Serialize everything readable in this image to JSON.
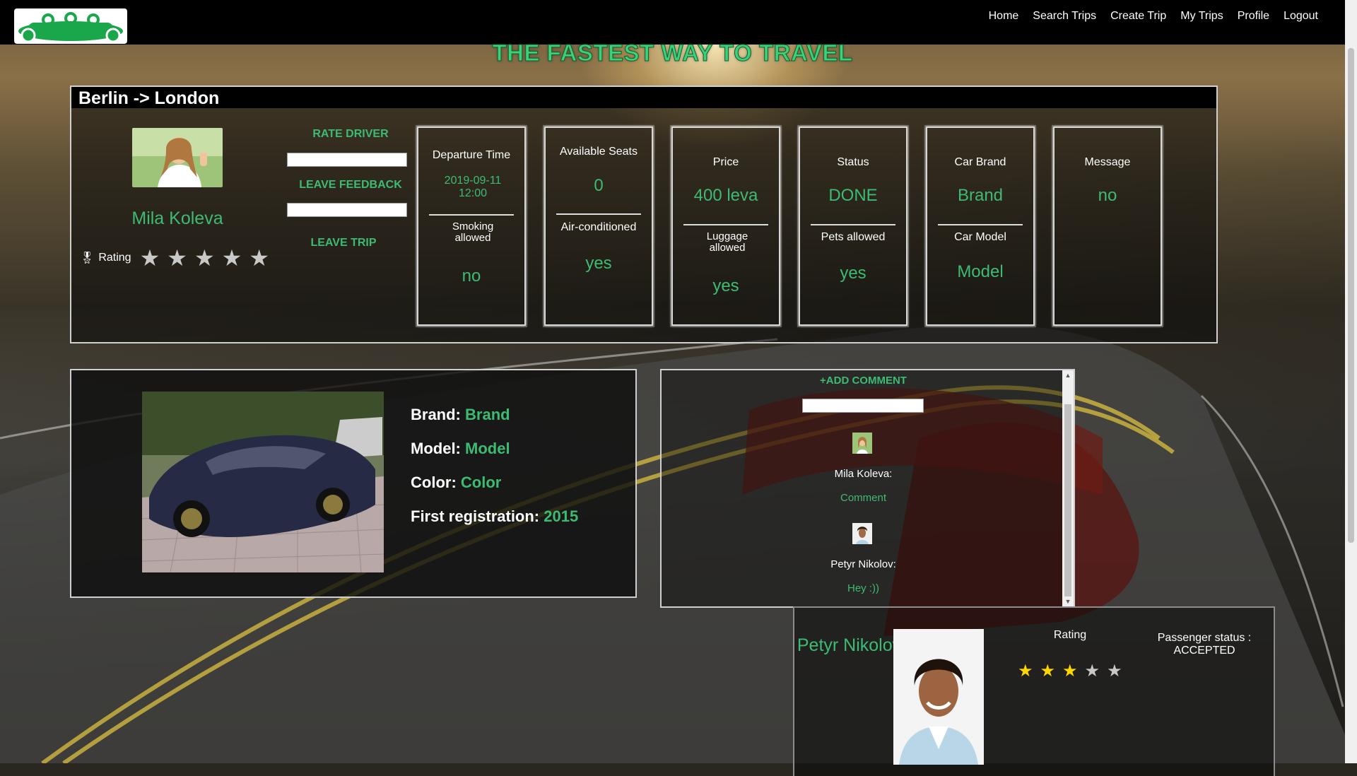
{
  "nav": {
    "items": [
      {
        "label": "Home"
      },
      {
        "label": "Search Trips"
      },
      {
        "label": "Create Trip"
      },
      {
        "label": "My Trips"
      },
      {
        "label": "Profile"
      },
      {
        "label": "Logout"
      }
    ]
  },
  "tagline": "THE FASTEST WAY TO TRAVEL",
  "trip": {
    "title": "Berlin -> London",
    "driver_name": "Mila Koleva",
    "rating_label": "Rating",
    "driver_rating_filled": 0,
    "actions": {
      "rate_driver": "RATE DRIVER",
      "leave_feedback": "LEAVE FEEDBACK",
      "leave_trip": "LEAVE TRIP"
    },
    "boxes": [
      {
        "top_label": "Departure Time",
        "top_value": "2019-09-11 12:00",
        "bottom_label": "Smoking allowed",
        "bottom_value": "no"
      },
      {
        "top_label": "Available Seats",
        "top_value": "0",
        "bottom_label": "Air-conditioned",
        "bottom_value": "yes"
      },
      {
        "top_label": "Price",
        "top_value": "400 leva",
        "bottom_label": "Luggage allowed",
        "bottom_value": "yes"
      },
      {
        "top_label": "Status",
        "top_value": "DONE",
        "bottom_label": "Pets allowed",
        "bottom_value": "yes"
      },
      {
        "top_label": "Car Brand",
        "top_value": "Brand",
        "bottom_label": "Car Model",
        "bottom_value": "Model"
      },
      {
        "top_label": "Message",
        "top_value": "no"
      }
    ]
  },
  "car": {
    "brand_label": "Brand:",
    "brand_value": "Brand",
    "model_label": "Model:",
    "model_value": "Model",
    "color_label": "Color:",
    "color_value": "Color",
    "reg_label": "First registration:",
    "reg_value": "2015"
  },
  "comments": {
    "add_label": "+ADD COMMENT",
    "items": [
      {
        "author": "Mila Koleva:",
        "text": "Comment"
      },
      {
        "author": "Petyr Nikolov:",
        "text": "Hey :))"
      }
    ]
  },
  "passenger": {
    "name": "Petyr Nikolov",
    "rating_label": "Rating",
    "rating_filled": 3,
    "rating_max": 5,
    "status": "Passenger status : ACCEPTED"
  },
  "colors": {
    "accent_green": "#3dbb73",
    "star_gold": "#ffd600",
    "star_grey": "#c8c8c8"
  },
  "icons": {
    "medal": "medal-icon",
    "star": "star-icon"
  }
}
